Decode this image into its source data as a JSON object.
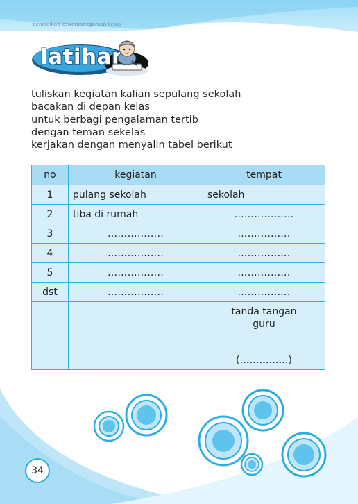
{
  "header": {
    "running_title": "pendidikan kewarganegaraan kelas I"
  },
  "badge": {
    "label": "latihan"
  },
  "instructions": [
    "tuliskan kegiatan kalian sepulang sekolah",
    "bacakan di depan kelas",
    "untuk berbagi pengalaman tertib",
    "dengan teman sekelas",
    "kerjakan dengan menyalin tabel berikut"
  ],
  "table": {
    "headers": [
      "no",
      "kegiatan",
      "tempat"
    ],
    "rows": [
      {
        "no": "1",
        "kegiatan": "pulang sekolah",
        "tempat": "sekolah"
      },
      {
        "no": "2",
        "kegiatan": "tiba di rumah",
        "tempat": "………………"
      },
      {
        "no": "3",
        "kegiatan": "……………..",
        "tempat": "……………."
      },
      {
        "no": "4",
        "kegiatan": "……………..",
        "tempat": "……………."
      },
      {
        "no": "5",
        "kegiatan": "……………..",
        "tempat": "……………."
      },
      {
        "no": "dst",
        "kegiatan": "……………..",
        "tempat": "……………."
      }
    ],
    "signature": {
      "label_line1": "tanda tangan",
      "label_line2": "guru",
      "placeholder": "(……………)"
    }
  },
  "footer": {
    "page_number": "34"
  },
  "colors": {
    "accent": "#29b3e6",
    "header_fill": "#a8dcf4",
    "cell_fill": "#d7effb",
    "badge_fill": "#3aa6df"
  }
}
